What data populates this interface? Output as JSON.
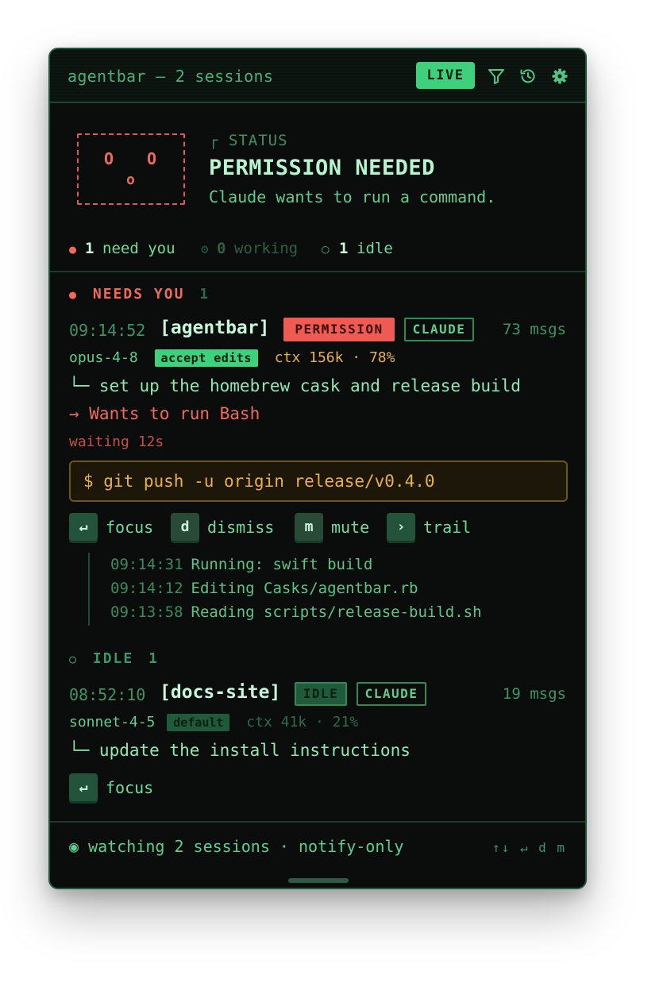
{
  "titlebar": {
    "title": "agentbar — 2 sessions",
    "live": "LIVE"
  },
  "status": {
    "caption": "┌ STATUS",
    "title": "PERMISSION NEEDED",
    "description": "Claude wants to run a command.",
    "face": {
      "left_eye": "O",
      "right_eye": "O",
      "mouth": "o"
    }
  },
  "counts": {
    "need_icon": "●",
    "need_num": "1",
    "need_label": "need you",
    "working_icon": "⚙",
    "working_num": "0",
    "working_label": "working",
    "idle_icon": "○",
    "idle_num": "1",
    "idle_label": "idle"
  },
  "needs_section": {
    "icon": "●",
    "label": "NEEDS YOU",
    "count": "1"
  },
  "session1": {
    "time": "09:14:52",
    "project": "[agentbar]",
    "state_badge": "PERMISSION",
    "agent_badge": "CLAUDE",
    "msgs": "73 msgs",
    "model": "opus-4-8",
    "mode": "accept edits",
    "ctx": "ctx 156k · 78%",
    "task": "└─ set up the homebrew cask and release build",
    "request": "→ Wants to run Bash",
    "waiting": "waiting 12s",
    "command": "$ git push -u origin release/v0.4.0",
    "actions": [
      {
        "key": "↵",
        "label": "focus"
      },
      {
        "key": "d",
        "label": "dismiss"
      },
      {
        "key": "m",
        "label": "mute"
      },
      {
        "key": "›",
        "label": "trail"
      }
    ],
    "trail": [
      {
        "time": "09:14:31",
        "msg": "Running: swift build"
      },
      {
        "time": "09:14:12",
        "msg": "Editing Casks/agentbar.rb"
      },
      {
        "time": "09:13:58",
        "msg": "Reading scripts/release-build.sh"
      }
    ]
  },
  "idle_section": {
    "icon": "○",
    "label": "IDLE",
    "count": "1"
  },
  "session2": {
    "time": "08:52:10",
    "project": "[docs-site]",
    "state_badge": "IDLE",
    "agent_badge": "CLAUDE",
    "msgs": "19 msgs",
    "model": "sonnet-4-5",
    "mode": "default",
    "ctx": "ctx 41k · 21%",
    "task": "└─ update the install instructions",
    "actions": [
      {
        "key": "↵",
        "label": "focus"
      }
    ]
  },
  "footer": {
    "status": "◉ watching 2 sessions · notify-only",
    "keys": "↑↓ ↵ d m"
  },
  "colors": {
    "accent": "#3fd07d",
    "alert": "#f06a5c",
    "warning": "#e8b04a",
    "background": "#0a0d0b"
  },
  "icons": [
    "filter-icon",
    "history-icon",
    "gear-icon"
  ]
}
